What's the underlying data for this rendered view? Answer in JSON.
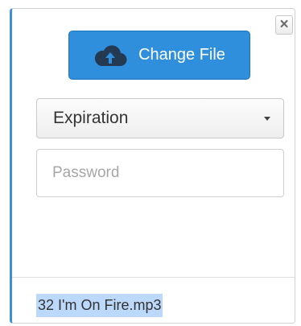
{
  "dialog": {
    "close_label": "×",
    "close_icon": "close-icon",
    "change_file_label": "Change File",
    "upload_icon": "cloud-upload-icon",
    "expiration_label": "Expiration",
    "password_placeholder": "Password",
    "password_value": "",
    "filename": "32 I'm On Fire.mp3"
  },
  "colors": {
    "accent": "#2f8fdd",
    "accent_border": "#3b8fe0",
    "selection": "#bcd8fb"
  }
}
